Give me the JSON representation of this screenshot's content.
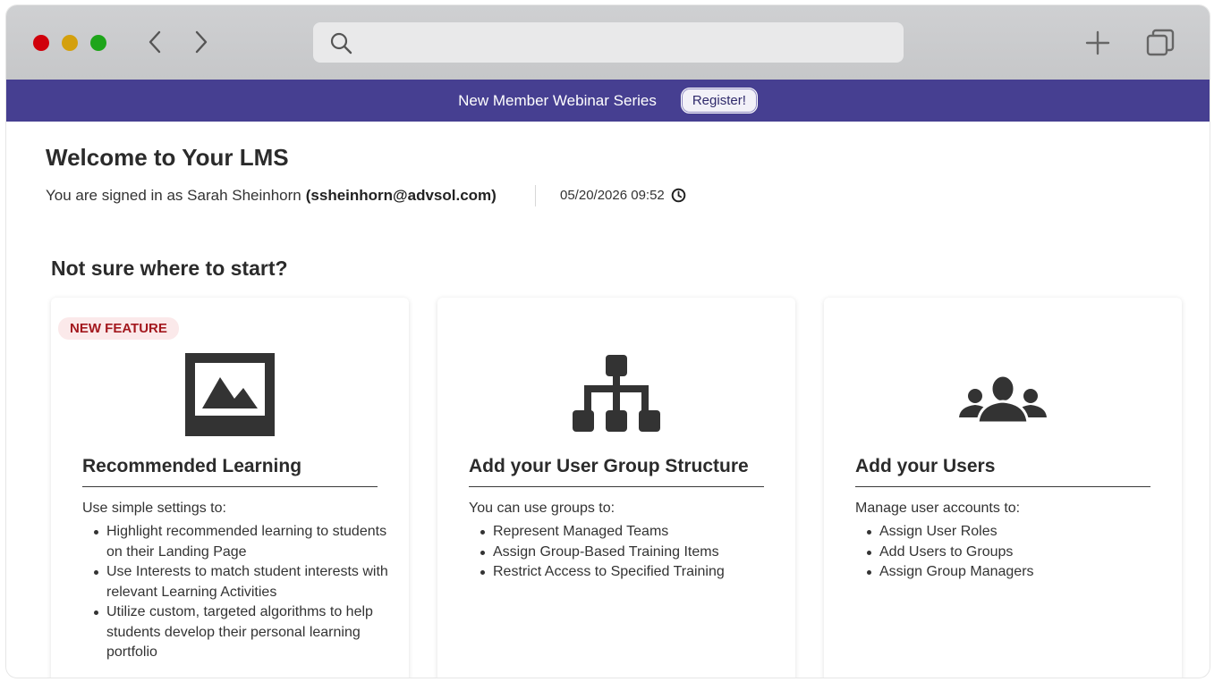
{
  "banner": {
    "text": "New Member Webinar Series",
    "button_label": "Register!",
    "background": "#463f91"
  },
  "header": {
    "title": "Welcome to Your LMS",
    "signed_in_prefix": "You are signed in as Sarah Sheinhorn",
    "email": "(ssheinhorn@advsol.com)",
    "datetime": "05/20/2026 09:52"
  },
  "section": {
    "title": "Not sure where to start?"
  },
  "cards": [
    {
      "badge": "NEW FEATURE",
      "icon": "image-icon",
      "title": "Recommended Learning",
      "intro": "Use simple settings to:",
      "items": [
        "Highlight recommended learning to students on their Landing Page",
        "Use Interests to match student interests with relevant Learning Activities",
        "Utilize custom, targeted algorithms to help students develop their personal learning portfolio"
      ]
    },
    {
      "icon": "hierarchy-icon",
      "title": "Add your User Group Structure",
      "intro": "You can use groups to:",
      "items": [
        "Represent Managed Teams",
        "Assign Group-Based Training Items",
        "Restrict Access to Specified Training"
      ]
    },
    {
      "icon": "users-icon",
      "title": "Add your Users",
      "intro": "Manage user accounts to:",
      "items": [
        "Assign User Roles",
        "Add Users to Groups",
        "Assign Group Managers"
      ]
    }
  ],
  "colors": {
    "badge_bg": "#fbe9ea",
    "badge_text": "#a3181e",
    "icon": "#333333"
  }
}
